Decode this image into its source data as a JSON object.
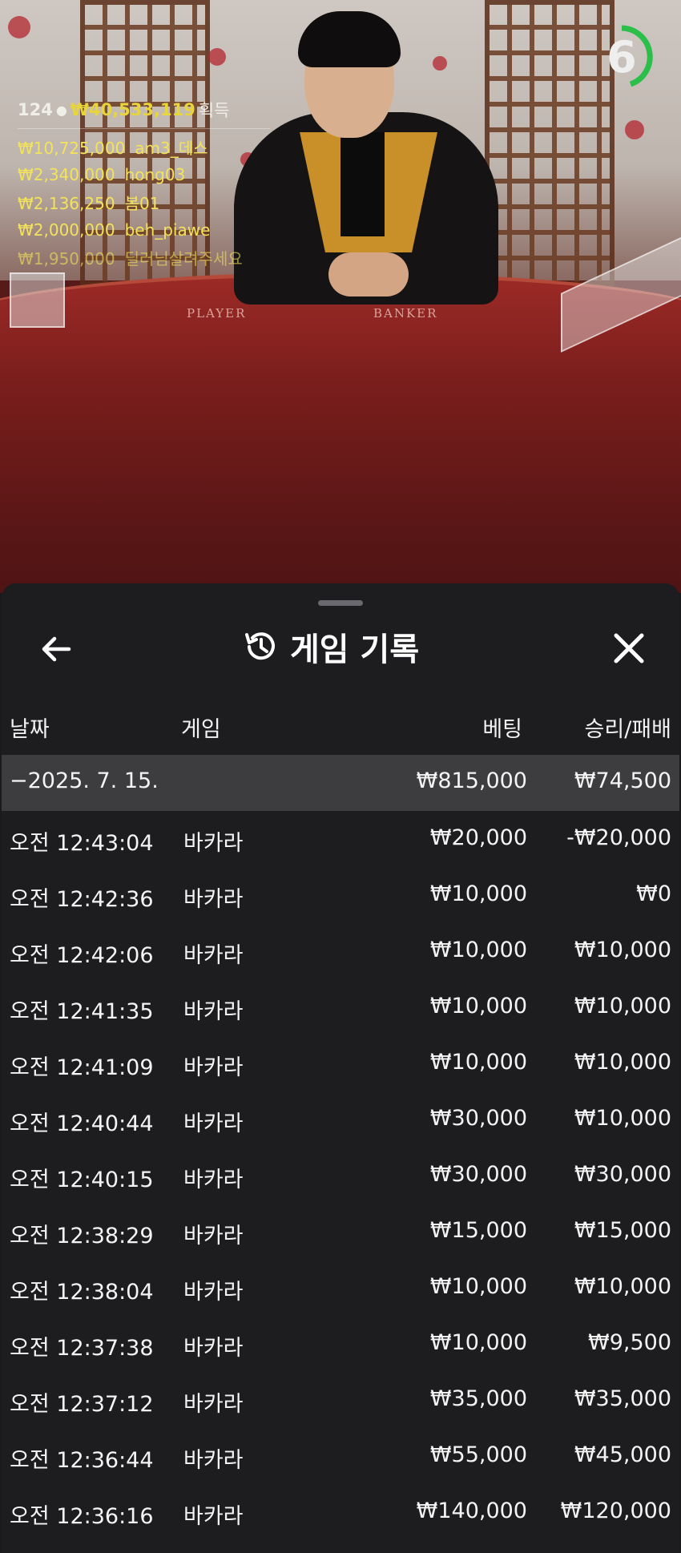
{
  "stream": {
    "player_label": "PLAYER",
    "banker_label": "BANKER",
    "timer": "6",
    "winners": {
      "count": "124",
      "total": "₩40,533,119",
      "earned_label": "획득",
      "list": [
        {
          "amount": "₩10,725,000",
          "name": "am3_데스"
        },
        {
          "amount": "₩2,340,000",
          "name": "hong03"
        },
        {
          "amount": "₩2,136,250",
          "name": "봄01"
        },
        {
          "amount": "₩2,000,000",
          "name": "beh_piawe"
        },
        {
          "amount": "₩1,950,000",
          "name": "딜러님살려주세요"
        }
      ]
    }
  },
  "sheet": {
    "title": "게임 기록",
    "columns": {
      "date": "날짜",
      "game": "게임",
      "bet": "베팅",
      "result": "승리/패배"
    },
    "summary": {
      "date": "−2025. 7. 15.",
      "bet": "₩815,000",
      "result": "₩74,500"
    },
    "rows": [
      {
        "time": "오전 12:43:04",
        "game": "바카라",
        "bet": "₩20,000",
        "result": "-₩20,000"
      },
      {
        "time": "오전 12:42:36",
        "game": "바카라",
        "bet": "₩10,000",
        "result": "₩0"
      },
      {
        "time": "오전 12:42:06",
        "game": "바카라",
        "bet": "₩10,000",
        "result": "₩10,000"
      },
      {
        "time": "오전 12:41:35",
        "game": "바카라",
        "bet": "₩10,000",
        "result": "₩10,000"
      },
      {
        "time": "오전 12:41:09",
        "game": "바카라",
        "bet": "₩10,000",
        "result": "₩10,000"
      },
      {
        "time": "오전 12:40:44",
        "game": "바카라",
        "bet": "₩30,000",
        "result": "₩10,000"
      },
      {
        "time": "오전 12:40:15",
        "game": "바카라",
        "bet": "₩30,000",
        "result": "₩30,000"
      },
      {
        "time": "오전 12:38:29",
        "game": "바카라",
        "bet": "₩15,000",
        "result": "₩15,000"
      },
      {
        "time": "오전 12:38:04",
        "game": "바카라",
        "bet": "₩10,000",
        "result": "₩10,000"
      },
      {
        "time": "오전 12:37:38",
        "game": "바카라",
        "bet": "₩10,000",
        "result": "₩9,500"
      },
      {
        "time": "오전 12:37:12",
        "game": "바카라",
        "bet": "₩35,000",
        "result": "₩35,000"
      },
      {
        "time": "오전 12:36:44",
        "game": "바카라",
        "bet": "₩55,000",
        "result": "₩45,000"
      },
      {
        "time": "오전 12:36:16",
        "game": "바카라",
        "bet": "₩140,000",
        "result": "₩120,000"
      }
    ]
  },
  "colors": {
    "winner_gold": "#e8d53a",
    "timer_green": "#2bbf4a",
    "sheet_bg": "#1d1d20",
    "summary_bg": "#3d3d40"
  },
  "icons": {
    "back": "arrow-left-icon",
    "history": "history-icon",
    "close": "close-icon",
    "person": "person-icon"
  }
}
